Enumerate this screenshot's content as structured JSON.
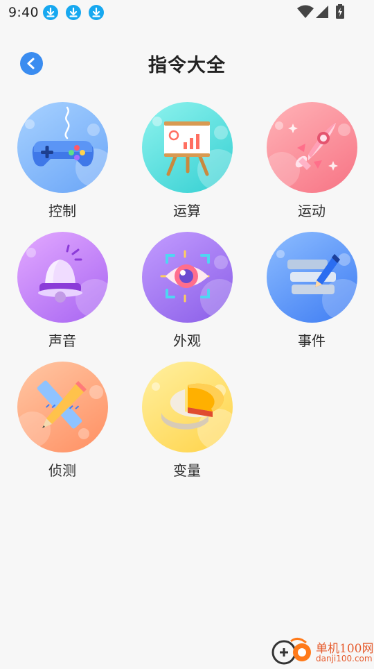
{
  "status": {
    "time": "9:40"
  },
  "header": {
    "title": "指令大全"
  },
  "categories": [
    {
      "label": "控制"
    },
    {
      "label": "运算"
    },
    {
      "label": "运动"
    },
    {
      "label": "声音"
    },
    {
      "label": "外观"
    },
    {
      "label": "事件"
    },
    {
      "label": "侦测"
    },
    {
      "label": "变量"
    }
  ],
  "watermark": {
    "brand": "单机100网",
    "url": "danji100.com"
  }
}
